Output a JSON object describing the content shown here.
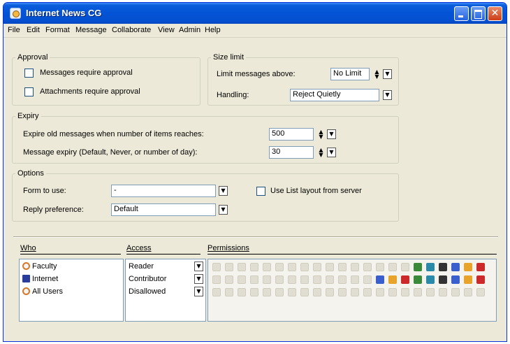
{
  "window": {
    "title": "Internet News CG"
  },
  "menu": [
    "File",
    "Edit",
    "Format",
    "Message",
    "Collaborate",
    "View",
    "Admin",
    "Help"
  ],
  "approval": {
    "legend": "Approval",
    "messages_label": "Messages require approval",
    "attachments_label": "Attachments require approval"
  },
  "size_limit": {
    "legend": "Size limit",
    "limit_label": "Limit messages above:",
    "limit_value": "No Limit",
    "handling_label": "Handling:",
    "handling_value": "Reject Quietly"
  },
  "expiry": {
    "legend": "Expiry",
    "items_label": "Expire old messages when number of items reaches:",
    "items_value": "500",
    "days_label": "Message expiry (Default, Never, or number of day):",
    "days_value": "30"
  },
  "options": {
    "legend": "Options",
    "form_label": "Form to use:",
    "form_value": "-",
    "list_layout_label": "Use List layout from server",
    "reply_label": "Reply preference:",
    "reply_value": "Default"
  },
  "permissions_table": {
    "headers": {
      "who": "Who",
      "access": "Access",
      "permissions": "Permissions"
    },
    "rows": [
      {
        "who": "Faculty",
        "icon": "group-icon",
        "access": "Reader",
        "perms_on": 6
      },
      {
        "who": "Internet",
        "icon": "internet-icon",
        "access": "Contributor",
        "perms_on": 9
      },
      {
        "who": "All Users",
        "icon": "group-icon",
        "access": "Disallowed",
        "perms_on": 0
      }
    ]
  },
  "colors": {
    "titlebar": "#0453d6",
    "window_bg": "#ece9d8",
    "close_button": "#cc3d17"
  }
}
